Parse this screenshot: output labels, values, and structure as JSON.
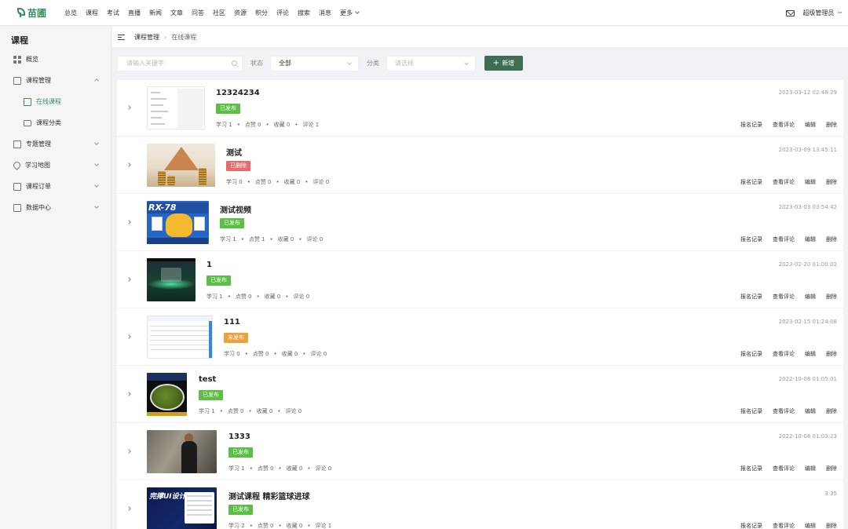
{
  "brand": {
    "name": "苗圃",
    "color": "#3b8f5c"
  },
  "nav": [
    "总览",
    "课程",
    "考试",
    "直播",
    "新闻",
    "文章",
    "问答",
    "社区",
    "资源",
    "积分",
    "评论",
    "搜索",
    "消息",
    "更多"
  ],
  "user": {
    "name": "超级管理员",
    "menu_icon": "more-dots-icon",
    "mail_icon": "mail-icon"
  },
  "sidebar": {
    "title": "课程",
    "items": [
      {
        "label": "概览",
        "icon": "grid-icon"
      },
      {
        "label": "课程管理",
        "icon": "book-icon",
        "expanded": true
      },
      {
        "label": "在线课程",
        "icon": "document-icon",
        "active": true
      },
      {
        "label": "课程分类",
        "icon": "folder-icon"
      },
      {
        "label": "专题管理",
        "icon": "topic-icon"
      },
      {
        "label": "学习地图",
        "icon": "map-pin-icon"
      },
      {
        "label": "课程订单",
        "icon": "order-icon"
      },
      {
        "label": "数据中心",
        "icon": "data-icon"
      }
    ]
  },
  "breadcrumb": {
    "parent": "课程管理",
    "current": "在线课程"
  },
  "filter": {
    "search_placeholder": "请输入关键字",
    "status_label": "状态",
    "status_value": "全部",
    "category_label": "分类",
    "category_placeholder": "请选择",
    "add_label": "新增"
  },
  "colors": {
    "published": "#5bbf45",
    "deleted": "#e96a6a",
    "unpublished": "#eba13c",
    "primary_button": "#3f6e55"
  },
  "actions": {
    "records": "报名记录",
    "comments": "查看评论",
    "edit": "编辑",
    "delete": "删除"
  },
  "courses": [
    {
      "title": "12324234",
      "status": "已发布",
      "status_color": "green",
      "date": "2023-03-12 02:48:29",
      "learn": "学习 1",
      "likes": "点赞 0",
      "favorites": "收藏 0",
      "comments": "评论 1"
    },
    {
      "title": "测试",
      "status": "已删除",
      "status_color": "red",
      "date": "2023-03-09 13:45:11",
      "learn": "学习 0",
      "likes": "点赞 0",
      "favorites": "收藏 0",
      "comments": "评论 0"
    },
    {
      "title": "测试视频",
      "status": "已发布",
      "status_color": "green",
      "date": "2023-03-03 03:54:42",
      "learn": "学习 1",
      "likes": "点赞 1",
      "favorites": "收藏 0",
      "comments": "评论 0"
    },
    {
      "title": "1",
      "status": "已发布",
      "status_color": "green",
      "date": "2023-02-20 01:00:02",
      "learn": "学习 1",
      "likes": "点赞 0",
      "favorites": "收藏 0",
      "comments": "评论 0"
    },
    {
      "title": "111",
      "status": "未发布",
      "status_color": "orange",
      "date": "2023-02-15 01:24:08",
      "learn": "学习 0",
      "likes": "点赞 0",
      "favorites": "收藏 0",
      "comments": "评论 0"
    },
    {
      "title": "test",
      "status": "已发布",
      "status_color": "green",
      "date": "2022-10-08 01:05:01",
      "learn": "学习 1",
      "likes": "点赞 0",
      "favorites": "收藏 0",
      "comments": "评论 0"
    },
    {
      "title": "1333",
      "status": "已发布",
      "status_color": "green",
      "date": "2022-10-08 01:03:23",
      "learn": "学习 1",
      "likes": "点赞 0",
      "favorites": "收藏 0",
      "comments": "评论 0"
    },
    {
      "title": "测试课程 精彩篮球进球",
      "status": "已发布",
      "status_color": "green",
      "date": "3:35",
      "learn": "学习 2",
      "likes": "点赞 0",
      "favorites": "收藏 0",
      "comments": "评论 1"
    }
  ],
  "thumb_text": {
    "t3": "RX-78",
    "t8": "完撑UI设计 平节班"
  }
}
